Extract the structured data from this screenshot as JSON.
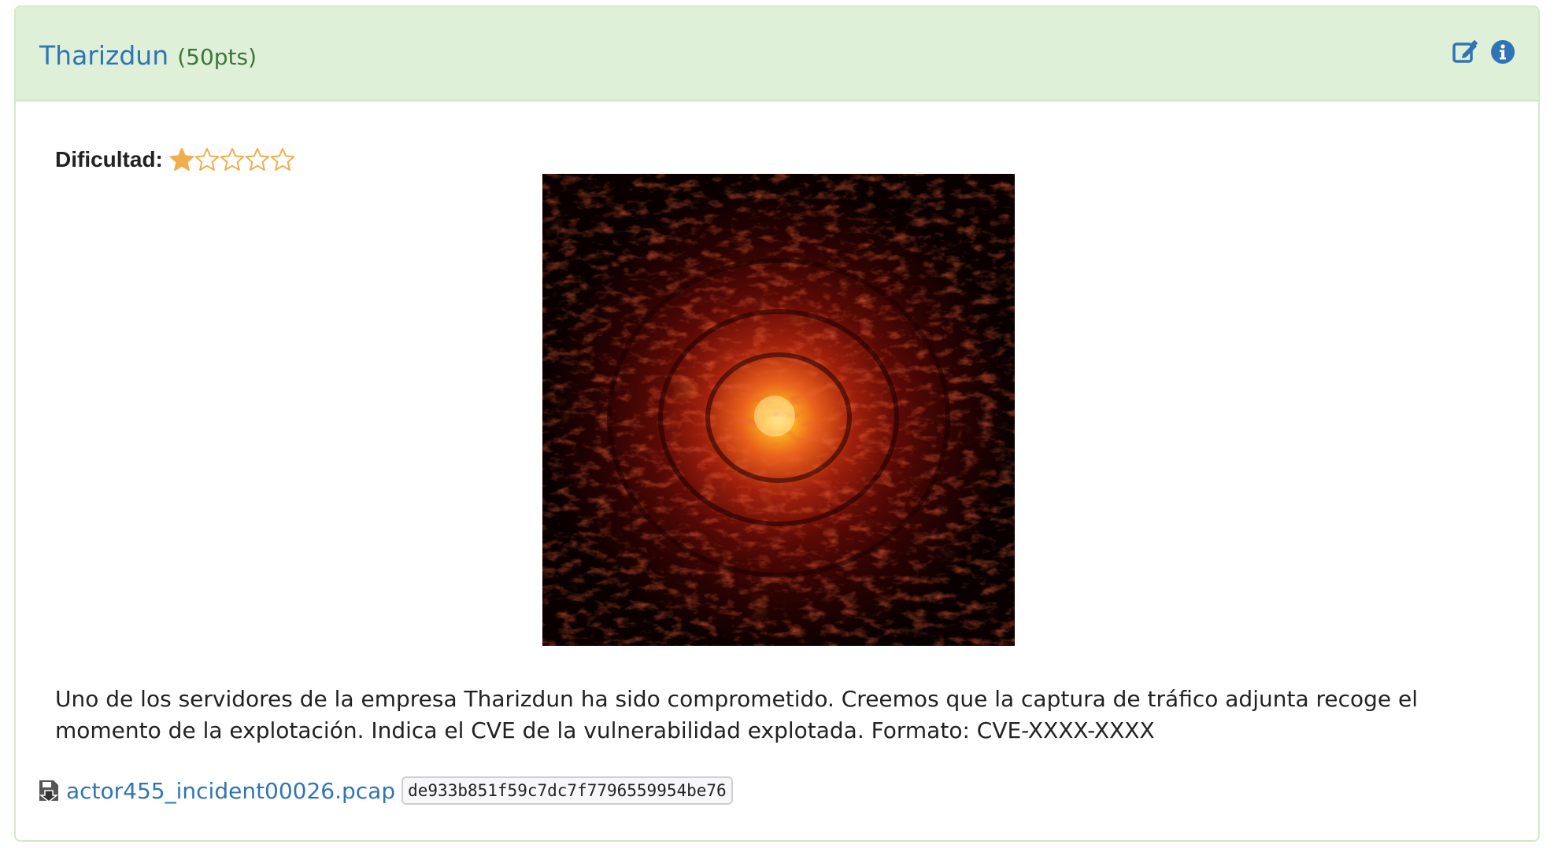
{
  "challenge": {
    "title": "Tharizdun",
    "points": "(50pts)",
    "difficulty_label": "Dificultad:",
    "difficulty_rating": 1,
    "difficulty_max": 5,
    "description": "Uno de los servidores de la empresa Tharizdun ha sido comprometido. Creemos que la captura de tráfico adjunta recoge el momento de la explotación. Indica el CVE de la vulnerabilidad explotada. Formato: CVE-XXXX-XXXX",
    "file": {
      "name": "actor455_incident00026.pcap",
      "hash": "de933b851f59c7dc7f7796559954be76"
    }
  },
  "header_icons": [
    "edit-icon",
    "info-icon"
  ],
  "colors": {
    "header_bg": "#dff0d8",
    "link": "#2f75b5",
    "points": "#3c763d",
    "star": "#f0ad4e"
  }
}
